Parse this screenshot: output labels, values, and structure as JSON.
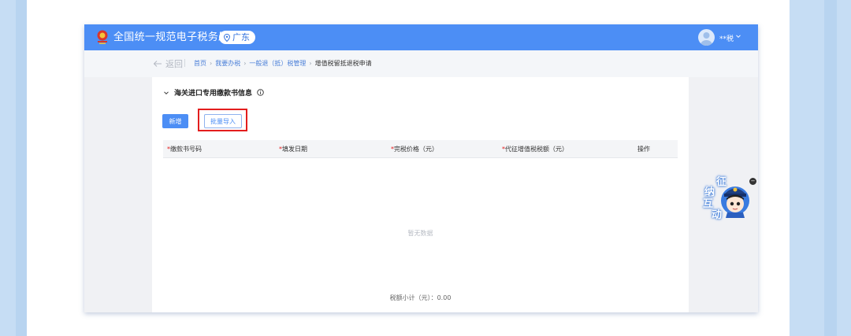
{
  "header": {
    "brand": "全国统一规范电子税务局",
    "region": "广东",
    "user": "**税"
  },
  "breadcrumb": {
    "back": "返回",
    "items": [
      "首页",
      "我要办税",
      "一般退（抵）税管理",
      "增值税留抵退税申请"
    ]
  },
  "section": {
    "title": "海关进口专用缴款书信息"
  },
  "buttons": {
    "add": "新增",
    "import": "批量导入"
  },
  "table": {
    "columns": [
      {
        "required": "*",
        "label": "缴款书号码"
      },
      {
        "required": "*",
        "label": "填发日期"
      },
      {
        "required": "*",
        "label": "完税价格（元）"
      },
      {
        "required": "*",
        "label": "代征增值税税额（元）"
      },
      {
        "required": "",
        "label": "操作"
      }
    ],
    "empty": "暂无数据",
    "subtotal": "税额小计（元）：0.00"
  },
  "mascot": {
    "chars": [
      "征",
      "纳",
      "互",
      "动"
    ],
    "close": "−"
  },
  "colors": {
    "accent": "#4c8ef5",
    "highlight": "#e31d1d"
  }
}
